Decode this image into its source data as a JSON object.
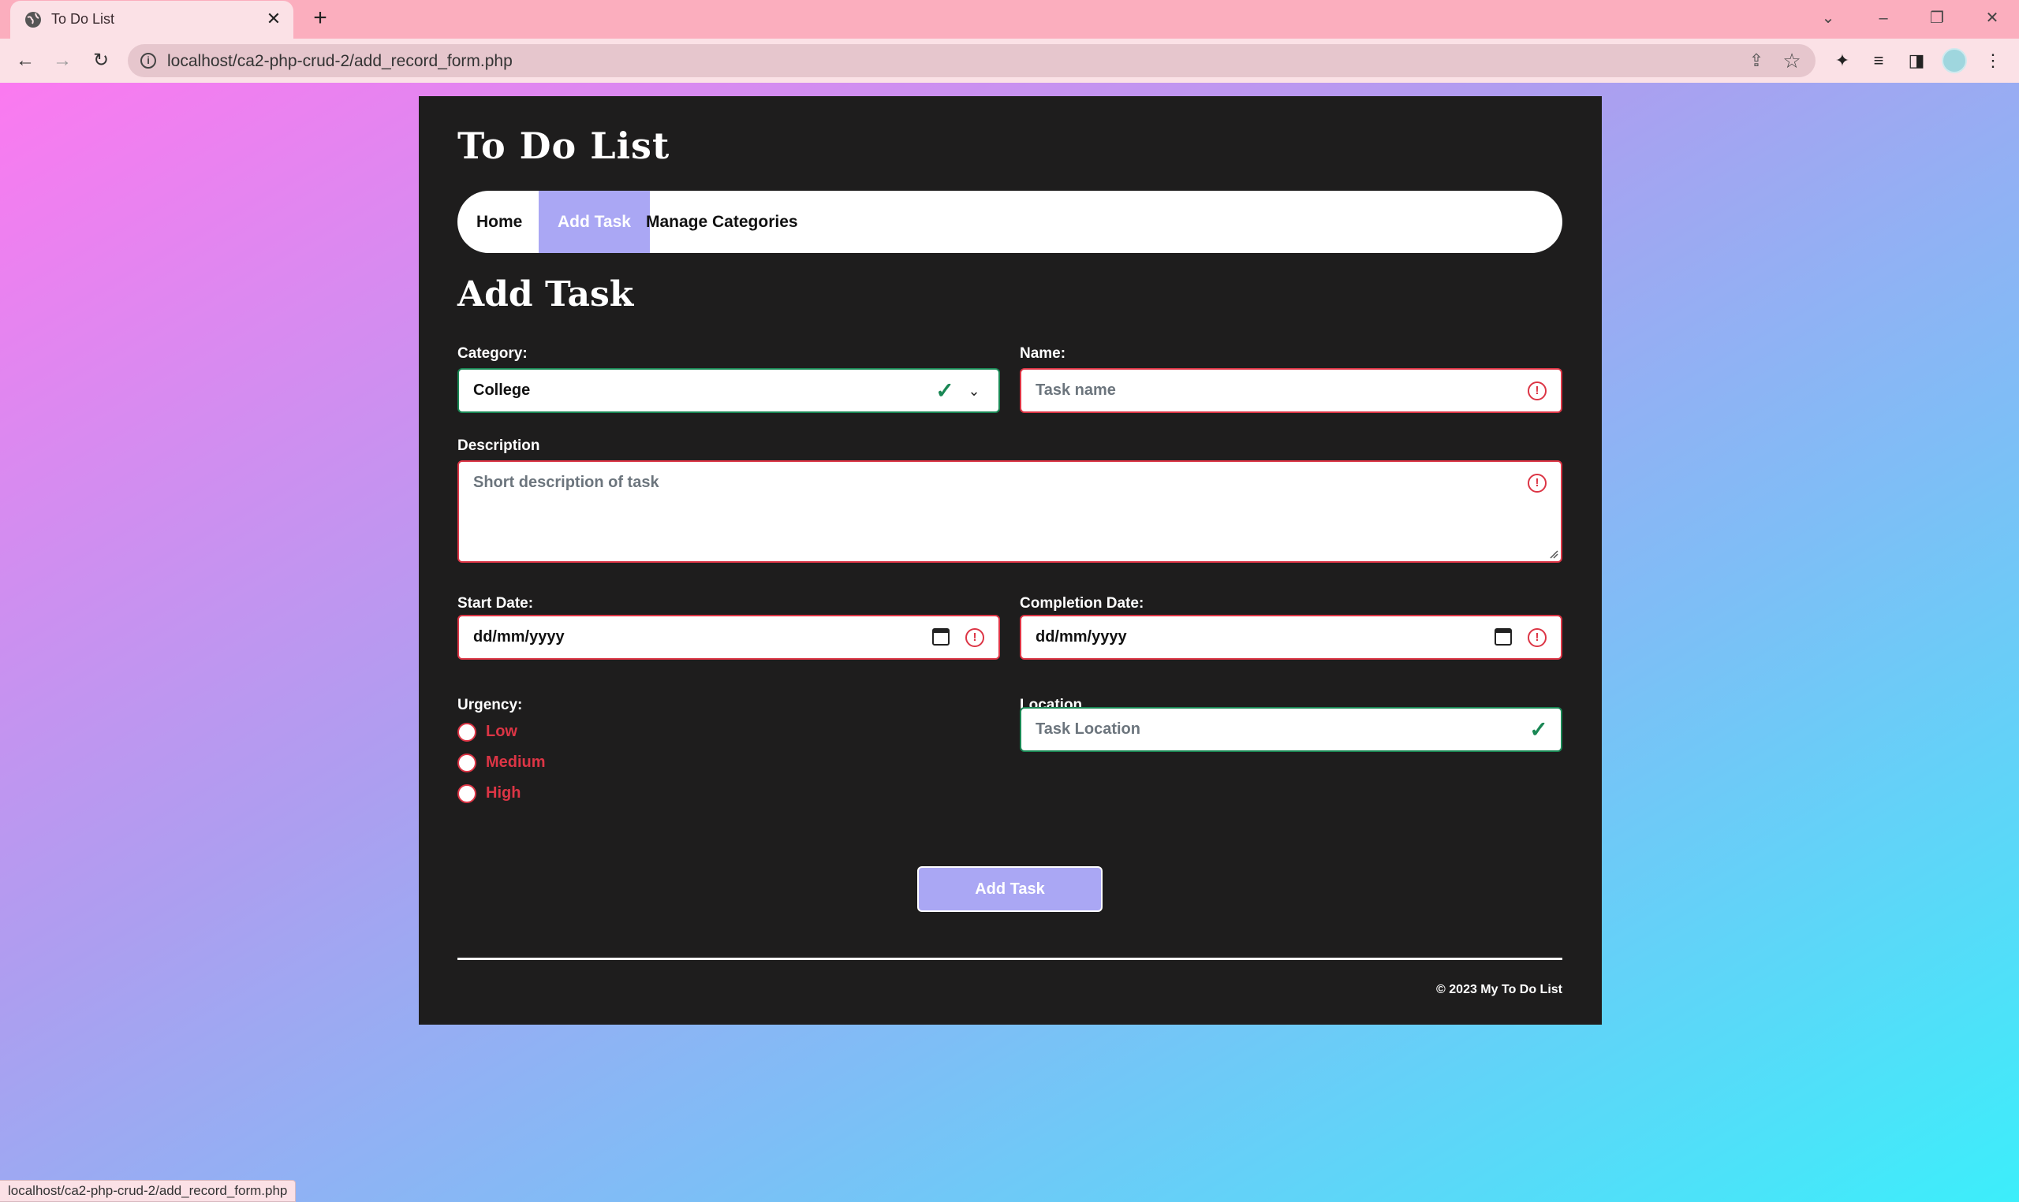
{
  "browser": {
    "tab_title": "To Do List",
    "url": "localhost/ca2-php-crud-2/add_record_form.php",
    "status_url": "localhost/ca2-php-crud-2/add_record_form.php"
  },
  "site": {
    "title": "To Do List"
  },
  "nav": {
    "items": [
      {
        "label": "Home",
        "active": false
      },
      {
        "label": "Add Task",
        "active": true
      },
      {
        "label": "Manage Categories",
        "active": false
      }
    ]
  },
  "form": {
    "heading": "Add Task",
    "category": {
      "label": "Category:",
      "value": "College",
      "state": "valid"
    },
    "name": {
      "label": "Name:",
      "placeholder": "Task name",
      "state": "invalid"
    },
    "description": {
      "label": "Description",
      "placeholder": "Short description of task",
      "state": "invalid"
    },
    "start_date": {
      "label": "Start Date:",
      "value": "dd/mm/yyyy",
      "state": "invalid"
    },
    "completion_date": {
      "label": "Completion Date:",
      "value": "dd/mm/yyyy",
      "state": "invalid"
    },
    "urgency": {
      "label": "Urgency:",
      "options": [
        "Low",
        "Medium",
        "High"
      ]
    },
    "location": {
      "label": "Location",
      "placeholder": "Task Location",
      "state": "valid"
    },
    "submit_label": "Add Task"
  },
  "footer": {
    "text": "© 2023 My To Do List"
  },
  "colors": {
    "accent": "#aaa7f4",
    "valid": "#198754",
    "invalid": "#dc3545",
    "card": "#1e1d1d"
  }
}
